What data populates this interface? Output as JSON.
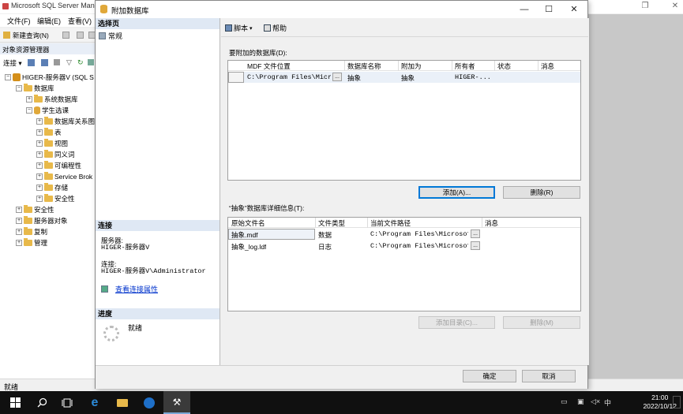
{
  "ssms": {
    "title": "Microsoft SQL Server Mana",
    "menu": [
      "文件(F)",
      "编辑(E)",
      "查看(V)"
    ],
    "new_query": "新建查询(N)",
    "object_explorer": {
      "title": "对象资源管理器",
      "connect": "连接 ▾",
      "server": "HIGER-服务器V (SQL S",
      "tree": [
        "数据库",
        "系统数据库",
        "学生选课",
        "数据库关系图",
        "表",
        "视图",
        "同义词",
        "可编程性",
        "Service Brok",
        "存储",
        "安全性",
        "安全性",
        "服务器对象",
        "复制",
        "管理"
      ]
    },
    "status": "就绪"
  },
  "dialog": {
    "title": "附加数据库",
    "left": {
      "select_page": "选择页",
      "general": "常规",
      "connection_head": "连接",
      "server_label": "服务器:",
      "server_value": "HIGER-服务器V",
      "connection_label": "连接:",
      "connection_value": "HIGER-服务器V\\Administrator",
      "view_props": "查看连接属性",
      "progress_head": "进度",
      "progress_status": "就绪"
    },
    "toolbar": {
      "script": "脚本",
      "help": "帮助"
    },
    "attach_label": "要附加的数据库(D):",
    "attach_grid": {
      "headers": [
        "MDF 文件位置",
        "数据库名称",
        "附加为",
        "所有者",
        "状态",
        "消息"
      ],
      "rows": [
        {
          "mdf": "C:\\Program Files\\Micr...",
          "ellipsis": "...",
          "dbname": "抽象",
          "attach_as": "抽象",
          "owner": "HIGER-...",
          "status": "",
          "message": ""
        }
      ]
    },
    "add_button": "添加(A)...",
    "remove_button": "删除(R)",
    "details_label": "“抽象”数据库详细信息(T):",
    "details_grid": {
      "headers": [
        "原始文件名",
        "文件类型",
        "当前文件路径",
        "消息"
      ],
      "rows": [
        {
          "name": "抽象.mdf",
          "type": "数据",
          "path": "C:\\Program Files\\Microsof...",
          "ellipsis": "...",
          "message": ""
        },
        {
          "name": "抽象_log.ldf",
          "type": "日志",
          "path": "C:\\Program Files\\Microsof...",
          "ellipsis": "...",
          "message": ""
        }
      ]
    },
    "add_catalog_button": "添加目录(C)...",
    "remove_m_button": "删除(M)",
    "ok_button": "确定",
    "cancel_button": "取消"
  },
  "taskbar": {
    "time": "21:00",
    "date": "2022/10/12",
    "ime": "中"
  }
}
